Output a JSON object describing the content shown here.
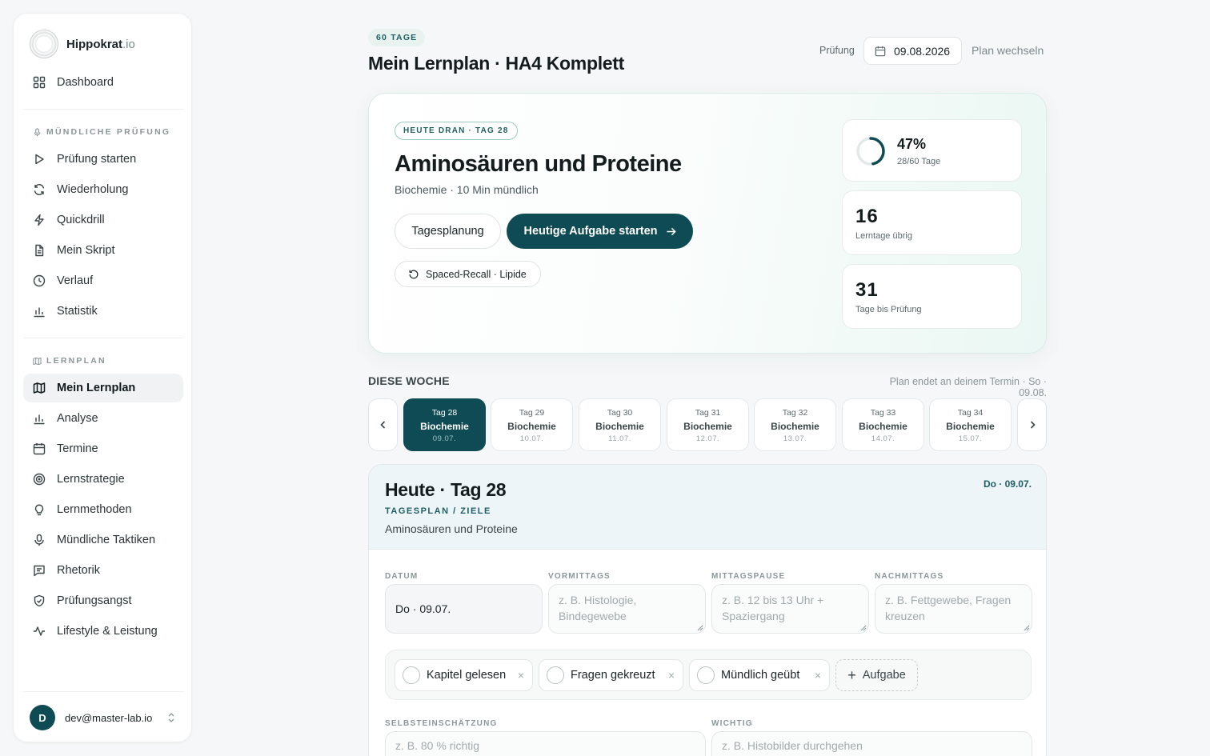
{
  "brand": {
    "name": "Hippokrat",
    "tld": ".io"
  },
  "sidebar": {
    "dashboard": "Dashboard",
    "section_oral": "MÜNDLICHE PRÜFUNG",
    "oral_items": [
      "Prüfung starten",
      "Wiederholung",
      "Quickdrill",
      "Mein Skript",
      "Verlauf",
      "Statistik"
    ],
    "section_plan": "LERNPLAN",
    "plan_items": [
      "Mein Lernplan",
      "Analyse",
      "Termine",
      "Lernstrategie",
      "Lernmethoden",
      "Mündliche Taktiken",
      "Rhetorik",
      "Prüfungsangst",
      "Lifestyle & Leistung"
    ],
    "active_item": "Mein Lernplan"
  },
  "user": {
    "initial": "D",
    "email": "dev@master-lab.io"
  },
  "header": {
    "days_badge": "60 TAGE",
    "title": "Mein Lernplan · HA4 Komplett",
    "exam_label": "Prüfung",
    "exam_date": "09.08.2026",
    "plan_switch": "Plan wechseln"
  },
  "hero": {
    "pill": "HEUTE DRAN · TAG 28",
    "title": "Aminosäuren und Proteine",
    "subtitle": "Biochemie · 10 Min mündlich",
    "btn_secondary": "Tagesplanung",
    "btn_primary": "Heutige Aufgabe starten",
    "recall_chip": "Spaced-Recall · Lipide",
    "progress": {
      "percent_label": "47%",
      "percent": 47,
      "sub": "28/60 Tage"
    },
    "stats": [
      {
        "value": "16",
        "label": "Lerntage übrig"
      },
      {
        "value": "31",
        "label": "Tage bis Prüfung"
      }
    ]
  },
  "week": {
    "title": "DIESE WOCHE",
    "note": "Plan endet an deinem Termin · So · 09.08.",
    "days": [
      {
        "label": "Tag 28",
        "subject": "Biochemie",
        "date": "09.07."
      },
      {
        "label": "Tag 29",
        "subject": "Biochemie",
        "date": "10.07."
      },
      {
        "label": "Tag 30",
        "subject": "Biochemie",
        "date": "11.07."
      },
      {
        "label": "Tag 31",
        "subject": "Biochemie",
        "date": "12.07."
      },
      {
        "label": "Tag 32",
        "subject": "Biochemie",
        "date": "13.07."
      },
      {
        "label": "Tag 33",
        "subject": "Biochemie",
        "date": "14.07."
      },
      {
        "label": "Tag 34",
        "subject": "Biochemie",
        "date": "15.07."
      }
    ]
  },
  "dayplan": {
    "title": "Heute · Tag 28",
    "kicker": "TAGESPLAN / ZIELE",
    "topic": "Aminosäuren und Proteine",
    "date": "Do · 09.07.",
    "fields": [
      {
        "label": "DATUM",
        "value": "Do · 09.07.",
        "placeholder": ""
      },
      {
        "label": "VORMITTAGS",
        "value": "",
        "placeholder": "z. B. Histologie, Bindegewebe"
      },
      {
        "label": "MITTAGSPAUSE",
        "value": "",
        "placeholder": "z. B. 12 bis 13 Uhr + Spaziergang"
      },
      {
        "label": "NACHMITTAGS",
        "value": "",
        "placeholder": "z. B. Fettgewebe, Fragen kreuzen"
      }
    ],
    "tasks": [
      "Kapitel gelesen",
      "Fragen gekreuzt",
      "Mündlich geübt"
    ],
    "add_task": "Aufgabe",
    "self_label": "SELBSTEINSCHÄTZUNG",
    "self_placeholder": "z. B. 80 % richtig",
    "important_label": "WICHTIG",
    "important_placeholder": "z. B. Histobilder durchgehen"
  }
}
